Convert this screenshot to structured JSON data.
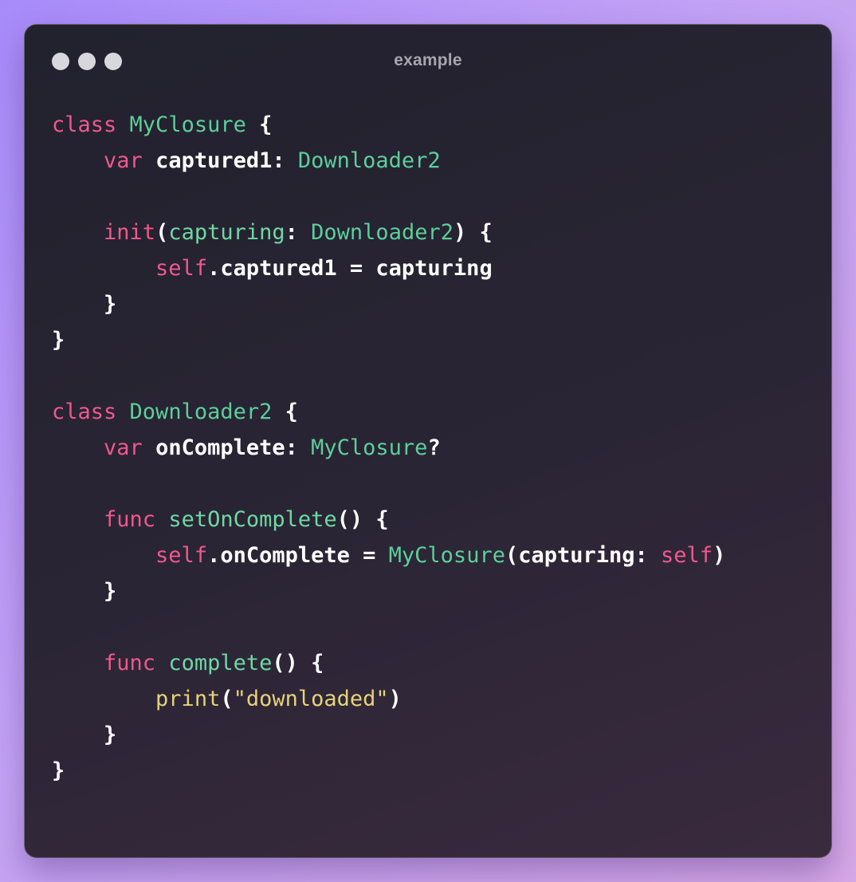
{
  "window": {
    "title": "example"
  },
  "code": {
    "language": "swift",
    "colors": {
      "keyword": "#f0588d",
      "type": "#5ccf9a",
      "string": "#e6d27a",
      "plain": "#ffffff"
    },
    "lines": [
      [
        {
          "t": "class",
          "k": "kw"
        },
        {
          "t": " "
        },
        {
          "t": "MyClosure",
          "k": "ty"
        },
        {
          "t": " {"
        }
      ],
      [
        {
          "t": "    "
        },
        {
          "t": "var",
          "k": "kw"
        },
        {
          "t": " captured1: "
        },
        {
          "t": "Downloader2",
          "k": "ty"
        }
      ],
      [],
      [
        {
          "t": "    "
        },
        {
          "t": "init",
          "k": "kw"
        },
        {
          "t": "("
        },
        {
          "t": "capturing",
          "k": "fn"
        },
        {
          "t": ": "
        },
        {
          "t": "Downloader2",
          "k": "ty"
        },
        {
          "t": ") {"
        }
      ],
      [
        {
          "t": "        "
        },
        {
          "t": "self",
          "k": "kw"
        },
        {
          "t": ".captured1 = capturing"
        }
      ],
      [
        {
          "t": "    }"
        }
      ],
      [
        {
          "t": "}"
        }
      ],
      [],
      [
        {
          "t": "class",
          "k": "kw"
        },
        {
          "t": " "
        },
        {
          "t": "Downloader2",
          "k": "ty"
        },
        {
          "t": " {"
        }
      ],
      [
        {
          "t": "    "
        },
        {
          "t": "var",
          "k": "kw"
        },
        {
          "t": " onComplete: "
        },
        {
          "t": "MyClosure",
          "k": "ty"
        },
        {
          "t": "?"
        }
      ],
      [],
      [
        {
          "t": "    "
        },
        {
          "t": "func",
          "k": "kw"
        },
        {
          "t": " "
        },
        {
          "t": "setOnComplete",
          "k": "fn"
        },
        {
          "t": "() {"
        }
      ],
      [
        {
          "t": "        "
        },
        {
          "t": "self",
          "k": "kw"
        },
        {
          "t": ".onComplete = "
        },
        {
          "t": "MyClosure",
          "k": "ty"
        },
        {
          "t": "(capturing: "
        },
        {
          "t": "self",
          "k": "kw"
        },
        {
          "t": ")"
        }
      ],
      [
        {
          "t": "    }"
        }
      ],
      [],
      [
        {
          "t": "    "
        },
        {
          "t": "func",
          "k": "kw"
        },
        {
          "t": " "
        },
        {
          "t": "complete",
          "k": "fn"
        },
        {
          "t": "() {"
        }
      ],
      [
        {
          "t": "        "
        },
        {
          "t": "print",
          "k": "fncall"
        },
        {
          "t": "("
        },
        {
          "t": "\"downloaded\"",
          "k": "str"
        },
        {
          "t": ")"
        }
      ],
      [
        {
          "t": "    }"
        }
      ],
      [
        {
          "t": "}"
        }
      ]
    ]
  }
}
